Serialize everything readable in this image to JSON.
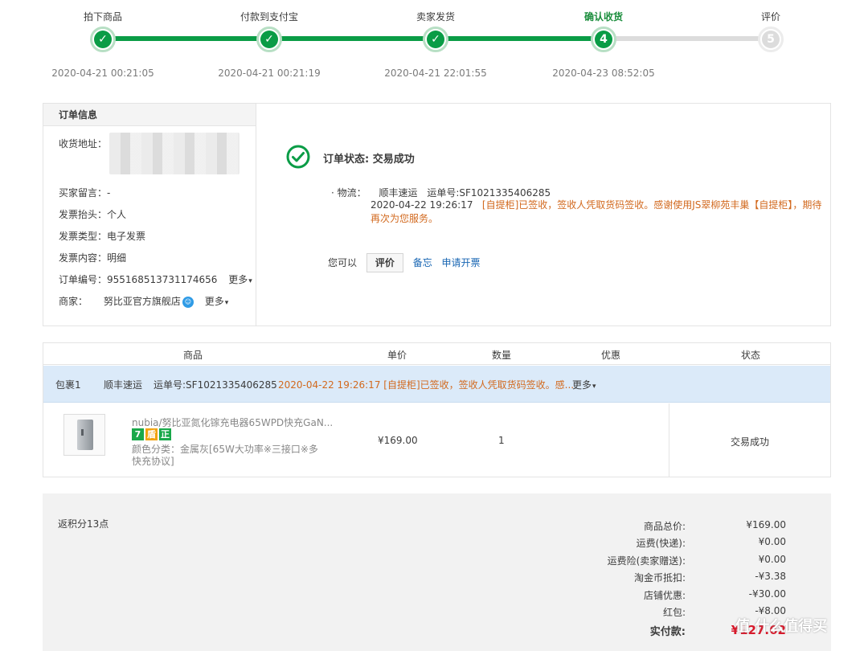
{
  "steps": [
    {
      "label": "拍下商品",
      "time": "2020-04-21 00:21:05",
      "state": "done",
      "mark": "✓"
    },
    {
      "label": "付款到支付宝",
      "time": "2020-04-21 00:21:19",
      "state": "done",
      "mark": "✓"
    },
    {
      "label": "卖家发货",
      "time": "2020-04-21 22:01:55",
      "state": "done",
      "mark": "✓"
    },
    {
      "label": "确认收货",
      "time": "2020-04-23 08:52:05",
      "state": "current",
      "mark": "4"
    },
    {
      "label": "评价",
      "time": "",
      "state": "pending",
      "mark": "5"
    }
  ],
  "order_info": {
    "heading": "订单信息",
    "address_label": "收货地址：",
    "buyer_msg_label": "买家留言：",
    "buyer_msg": "-",
    "invoice_title_label": "发票抬头：",
    "invoice_title": "个人",
    "invoice_type_label": "发票类型：",
    "invoice_type": "电子发票",
    "invoice_content_label": "发票内容：",
    "invoice_content": "明细",
    "order_no_label": "订单编号：",
    "order_no": "955168513731174656",
    "merchant_label": "商家：",
    "merchant": "努比亚官方旗舰店",
    "more": "更多"
  },
  "status": {
    "title": "订单状态: 交易成功",
    "logistics_prefix": "· 物流：",
    "carrier": "顺丰速运",
    "waybill": "运单号:SF1021335406285",
    "log_time": "2020-04-22 19:26:17",
    "log_msg": "[自提柜]已签收，签收人凭取货码签收。感谢使用JS翠柳苑丰巢【自提柜】，期待再次为您服务。",
    "actions_label": "您可以",
    "review_button": "评价",
    "memo_link": "备忘",
    "invoice_link": "申请开票"
  },
  "goods_table": {
    "headers": [
      "商品",
      "单价",
      "数量",
      "优惠",
      "状态"
    ],
    "package": {
      "name": "包裹1",
      "carrier": "顺丰速运",
      "waybill": "运单号:SF1021335406285",
      "log": "2020-04-22 19:26:17   [自提柜]已签收，签收人凭取货码签收。感...",
      "more": "更多"
    },
    "item": {
      "title": "nubia/努比亚氮化镓充电器65WPD快充GaN...",
      "badges": [
        "7",
        "盾",
        "正"
      ],
      "spec": "颜色分类：金属灰[65W大功率※三接口※多快充协议]",
      "price": "¥169.00",
      "qty": "1",
      "status": "交易成功"
    }
  },
  "summary": {
    "points": "返积分13点",
    "rows": [
      {
        "label": "商品总价:",
        "value": "¥169.00"
      },
      {
        "label": "运费(快递):",
        "value": "¥0.00"
      },
      {
        "label": "运费险(卖家赠送):",
        "value": "¥0.00"
      },
      {
        "label": "淘金币抵扣:",
        "value": "-¥3.38"
      },
      {
        "label": "店铺优惠:",
        "value": "-¥30.00"
      },
      {
        "label": "红包:",
        "value": "-¥8.00"
      }
    ],
    "total_label": "实付款:",
    "total_value": "¥127.62"
  },
  "watermark": "值 什么值得买",
  "colors": {
    "accent_green": "#0a9c46",
    "package_bg": "#dbeaf9",
    "orange_text": "#d2691e",
    "total_red": "#d7182a"
  }
}
